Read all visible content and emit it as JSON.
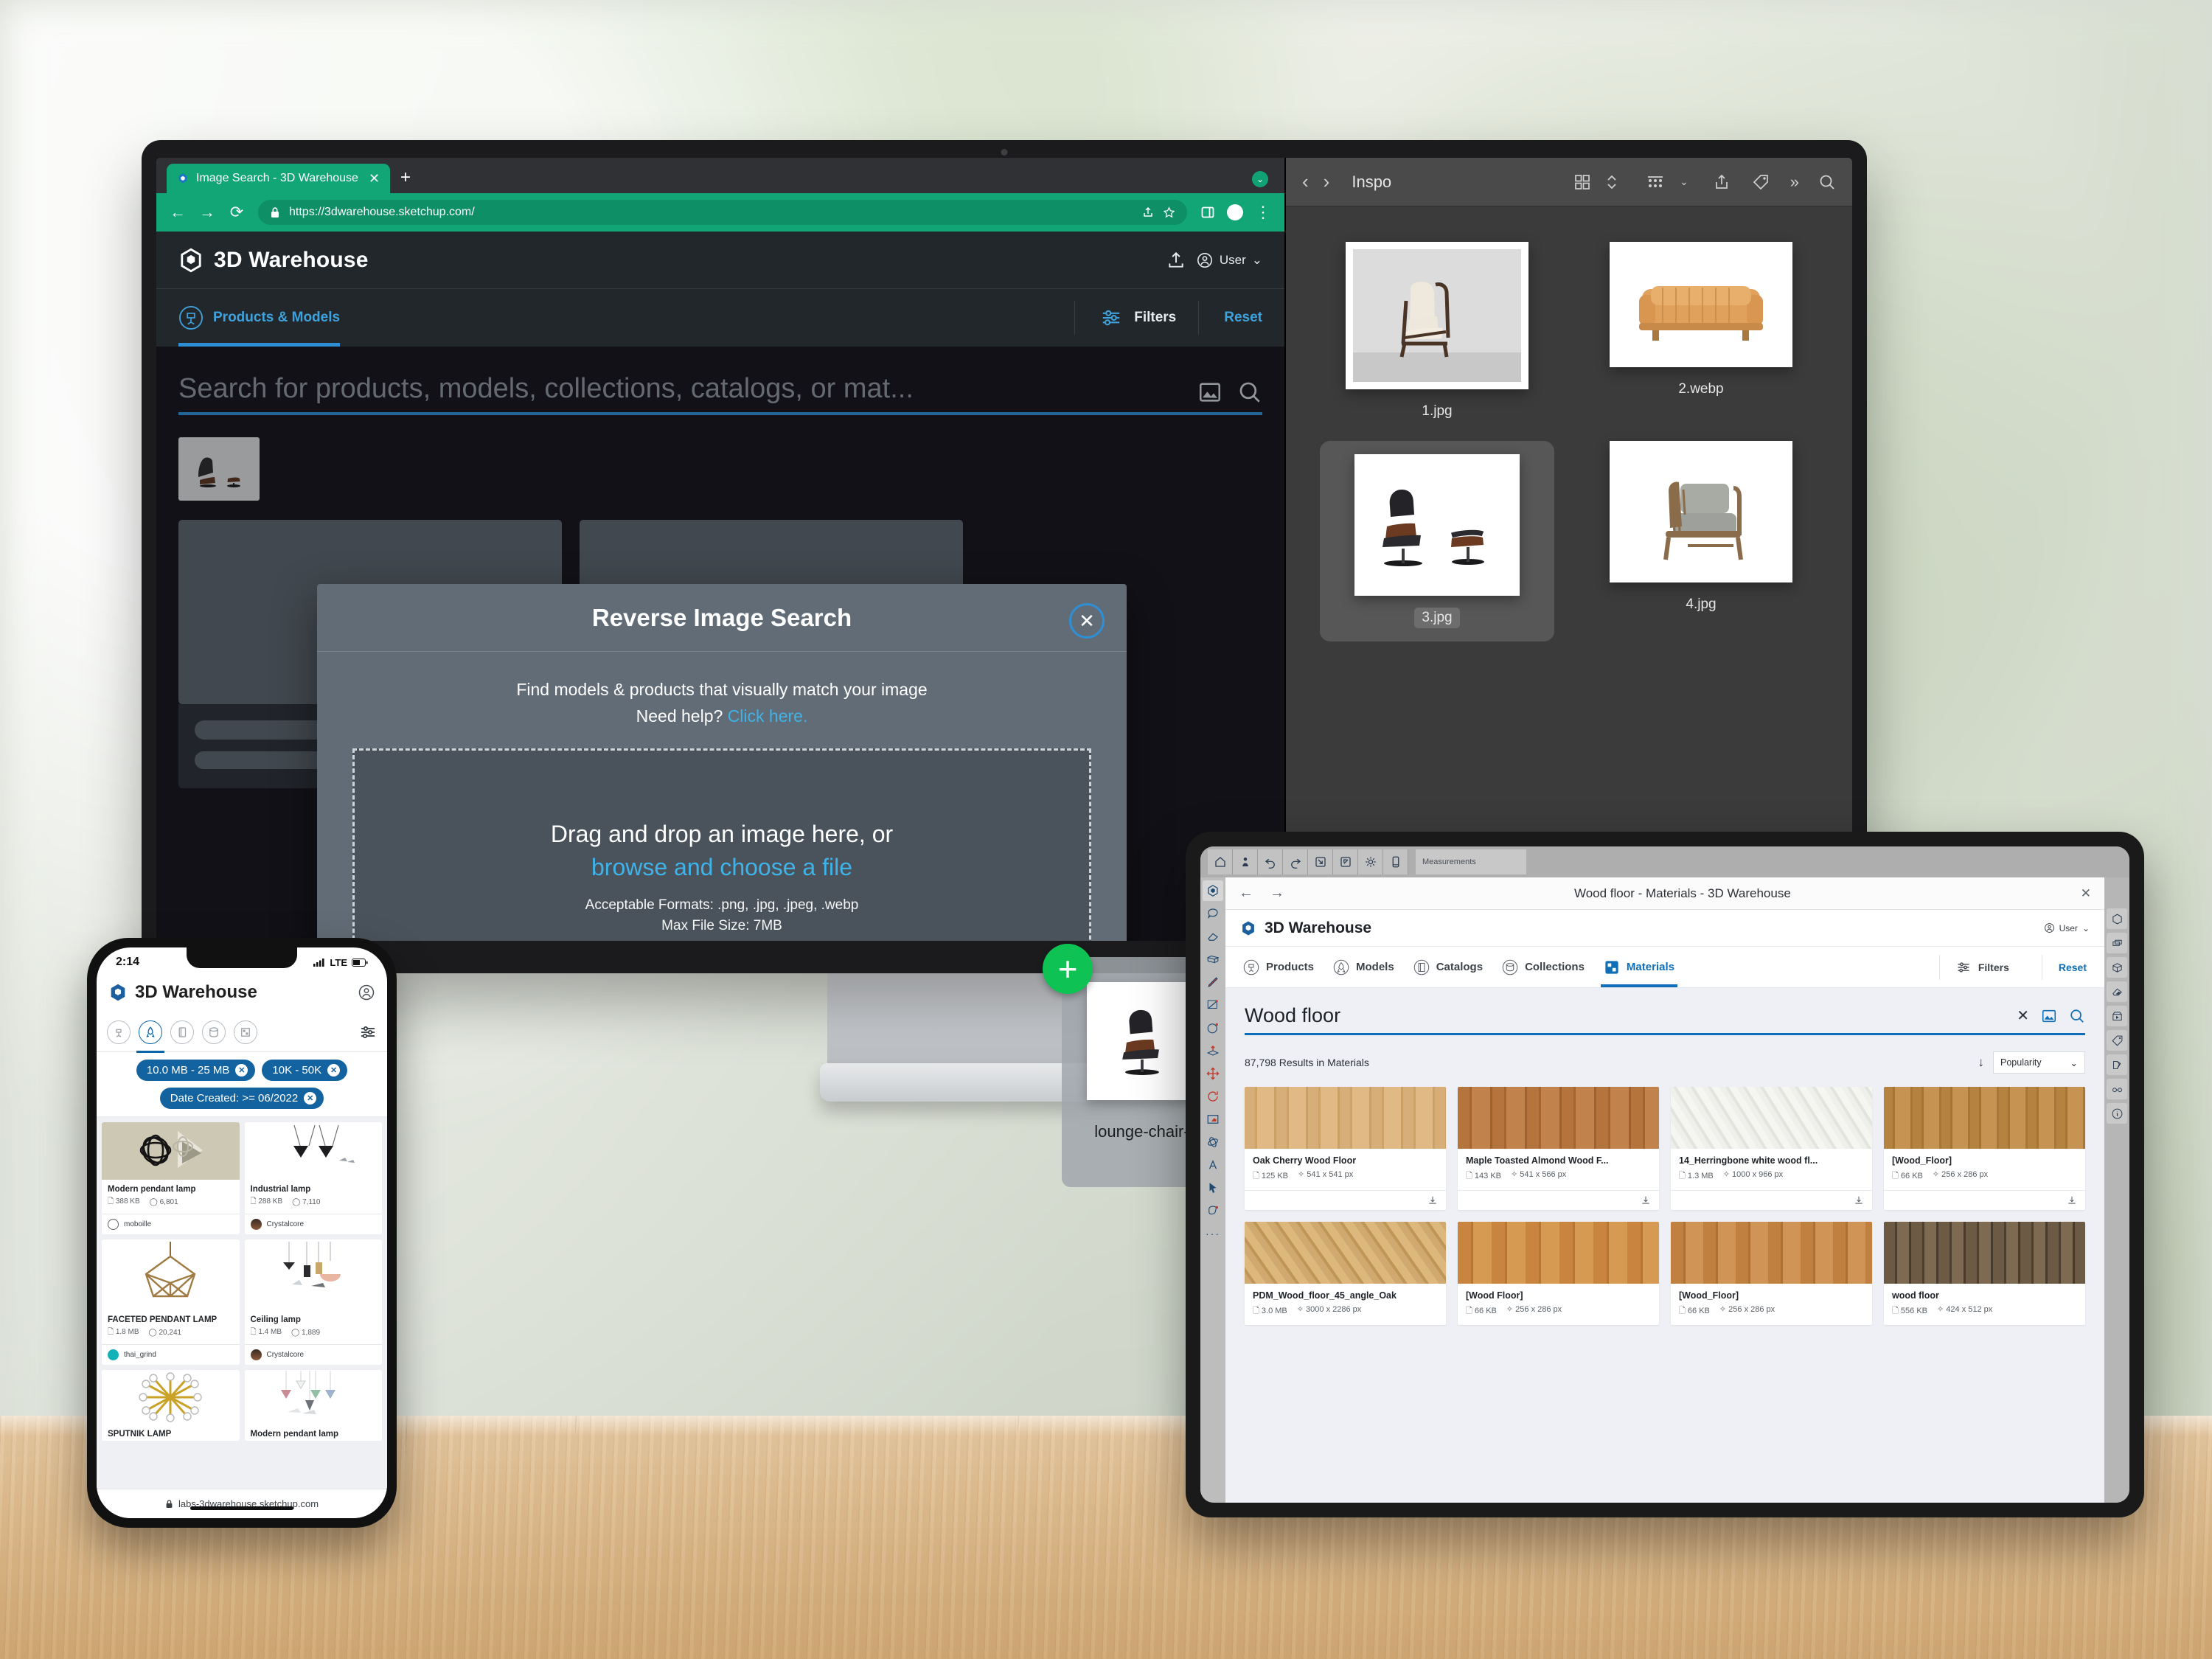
{
  "desktop": {
    "browser": {
      "tab_title": "Image Search - 3D Warehouse",
      "tab_close": "✕",
      "new_tab": "+",
      "url": "https://3dwarehouse.sketchup.com/",
      "nav_back": "←",
      "nav_forward": "→",
      "nav_reload": "⟳",
      "menu": "⋮"
    },
    "site": {
      "brand": "3D Warehouse",
      "user_label": "User",
      "user_caret": "⌄",
      "tab_products_models": "Products & Models",
      "filters_label": "Filters",
      "reset_label": "Reset",
      "search_placeholder": "Search for products, models, collections, catalogs, or mat..."
    },
    "modal": {
      "title": "Reverse Image Search",
      "close": "✕",
      "subtitle_line1": "Find models & products that visually match your image",
      "subtitle_line2_prefix": "Need help? ",
      "subtitle_link": "Click here.",
      "drop_line1": "Drag and drop an image here, or",
      "drop_link": "browse and choose a file",
      "formats": "Acceptable Formats: .png, .jpg, .jpeg, .webp",
      "max_size": "Max File Size: 7MB"
    },
    "drag": {
      "filename": "lounge-chair-inspo.jpg",
      "badge": "+"
    }
  },
  "finder": {
    "back": "‹",
    "forward": "›",
    "title": "Inspo",
    "items": [
      {
        "label": "1.jpg",
        "selected": false
      },
      {
        "label": "2.webp",
        "selected": false
      },
      {
        "label": "3.jpg",
        "selected": true
      },
      {
        "label": "4.jpg",
        "selected": false
      }
    ]
  },
  "phone": {
    "status_time": "2:14",
    "status_network": "LTE",
    "brand": "3D Warehouse",
    "chips": [
      {
        "label": "10.0 MB - 25 MB",
        "remove": "✕"
      },
      {
        "label": "10K - 50K",
        "remove": "✕"
      },
      {
        "label": "Date Created: >= 06/2022",
        "remove": "✕"
      }
    ],
    "cards": [
      {
        "title": "Modern pendant lamp",
        "size": "388 KB",
        "count": "6,801",
        "author": "moboille"
      },
      {
        "title": "Industrial lamp",
        "size": "288 KB",
        "count": "7,110",
        "author": "Crystalcore"
      },
      {
        "title": "FACETED PENDANT LAMP",
        "size": "1.8 MB",
        "count": "20,241",
        "author": "thai_grind"
      },
      {
        "title": "Ceiling lamp",
        "size": "1.4 MB",
        "count": "1,889",
        "author": "Crystalcore"
      },
      {
        "title": "SPUTNIK LAMP",
        "size": "",
        "count": "",
        "author": ""
      },
      {
        "title": "Modern pendant lamp",
        "size": "",
        "count": "",
        "author": ""
      }
    ],
    "url": "labs-3dwarehouse.sketchup.com"
  },
  "tablet": {
    "sketchup": {
      "measurements_label": "Measurements"
    },
    "window": {
      "title": "Wood floor - Materials - 3D Warehouse",
      "back": "←",
      "forward": "→",
      "close": "✕"
    },
    "site": {
      "brand": "3D Warehouse",
      "user_label": "User",
      "user_caret": "⌄",
      "tabs": [
        {
          "label": "Products",
          "active": false
        },
        {
          "label": "Models",
          "active": false
        },
        {
          "label": "Catalogs",
          "active": false
        },
        {
          "label": "Collections",
          "active": false
        },
        {
          "label": "Materials",
          "active": true
        }
      ],
      "filters_label": "Filters",
      "reset_label": "Reset",
      "query": "Wood floor",
      "clear": "✕",
      "results_count": "87,798 Results in Materials",
      "sort_label": "Popularity",
      "sort_caret": "⌄",
      "sort_arrow": "↓"
    },
    "materials": [
      {
        "title": "Oak Cherry Wood Floor",
        "size": "125 KB",
        "dims": "541 x 541 px",
        "tex": "tx-oak"
      },
      {
        "title": "Maple Toasted Almond Wood F...",
        "size": "143 KB",
        "dims": "541 x 566 px",
        "tex": "tx-maple"
      },
      {
        "title": "14_Herringbone white wood fl...",
        "size": "1.3 MB",
        "dims": "1000 x 966 px",
        "tex": "tx-herring"
      },
      {
        "title": "[Wood_Floor]",
        "size": "66 KB",
        "dims": "256 x 286 px",
        "tex": "tx-wf1"
      },
      {
        "title": "PDM_Wood_floor_45_angle_Oak",
        "size": "3.0 MB",
        "dims": "3000 x 2286 px",
        "tex": "tx-pdm"
      },
      {
        "title": "[Wood Floor]",
        "size": "66 KB",
        "dims": "256 x 286 px",
        "tex": "tx-wf2"
      },
      {
        "title": "[Wood_Floor]",
        "size": "66 KB",
        "dims": "256 x 286 px",
        "tex": "tx-wf3"
      },
      {
        "title": "wood floor",
        "size": "556 KB",
        "dims": "424 x 512 px",
        "tex": "tx-wood"
      }
    ]
  },
  "colors": {
    "chrome_green": "#12a575",
    "accent_blue": "#2f8fd4",
    "link_blue": "#3fb3e8",
    "tablet_blue": "#0e6fb8",
    "chip_blue": "#12639f",
    "plus_green": "#0ec253",
    "dark_panel": "#22272b",
    "dark_bg": "#15151c",
    "modal_bg": "#626c76"
  }
}
